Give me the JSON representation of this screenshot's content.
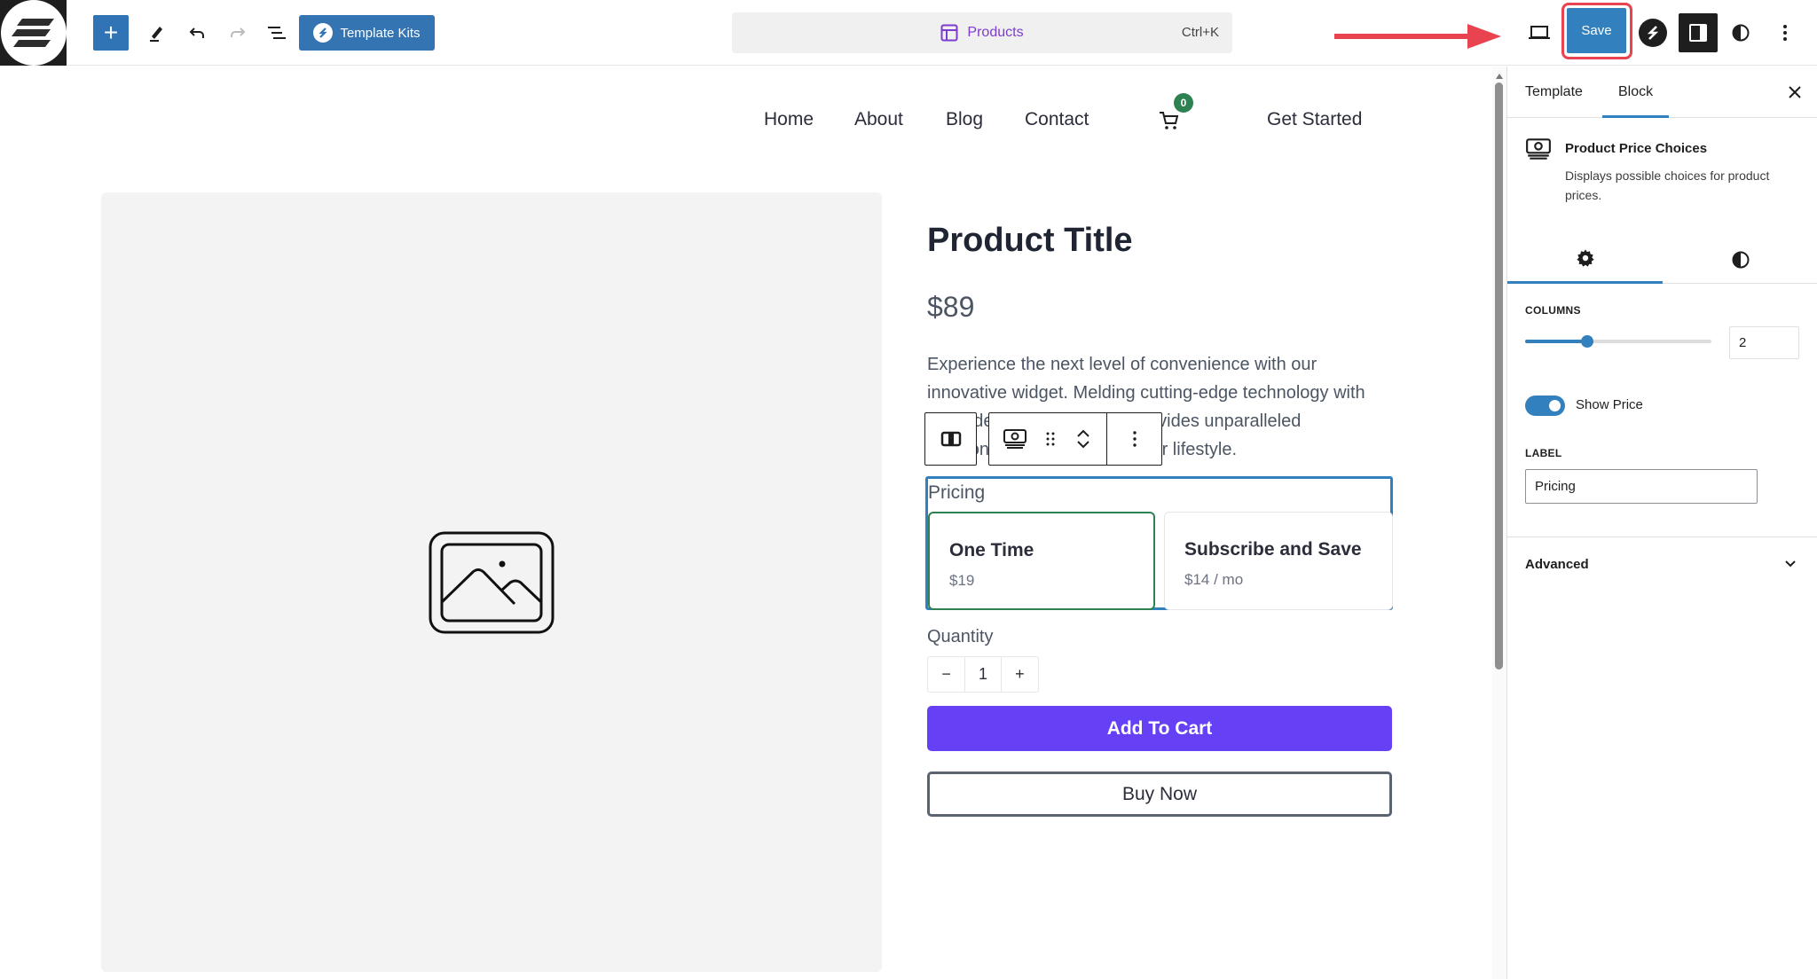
{
  "topbar": {
    "add_block_label": "+",
    "template_kits_label": "Template Kits",
    "command_bar": {
      "label": "Products",
      "shortcut": "Ctrl+K"
    },
    "save_label": "Save",
    "colors": {
      "primary": "#3280bd",
      "highlight": "#e8434e"
    }
  },
  "site_nav": {
    "links": [
      "Home",
      "About",
      "Blog",
      "Contact"
    ],
    "cart_count": "0",
    "cta": "Get Started"
  },
  "product": {
    "title": "Product Title",
    "price": "$89",
    "description": "Experience the next level of convenience with our innovative widget. Melding cutting-edge technology with sleek design, this product provides unparalleled functionality that caters to your lifestyle.",
    "pricing": {
      "label": "Pricing",
      "choices": [
        {
          "title": "One Time",
          "price": "$19",
          "selected": true
        },
        {
          "title": "Subscribe and Save",
          "price": "$14 / mo",
          "selected": false
        }
      ]
    },
    "quantity": {
      "label": "Quantity",
      "minus": "−",
      "value": "1",
      "plus": "+"
    },
    "add_to_cart": "Add To Cart",
    "buy_now": "Buy Now",
    "accent_color": "#6640f4"
  },
  "sidebar": {
    "tabs": [
      {
        "label": "Template",
        "active": false
      },
      {
        "label": "Block",
        "active": true
      }
    ],
    "block": {
      "title": "Product Price Choices",
      "description": "Displays possible choices for product prices."
    },
    "subtabs": [
      {
        "icon": "gear-icon",
        "active": true
      },
      {
        "icon": "contrast-icon",
        "active": false
      }
    ],
    "settings": {
      "columns_label": "Columns",
      "columns_value": "2",
      "columns_min": 1,
      "columns_max": 4,
      "show_price_label": "Show Price",
      "show_price": true,
      "label_label": "Label",
      "label_value": "Pricing"
    },
    "advanced_label": "Advanced"
  }
}
